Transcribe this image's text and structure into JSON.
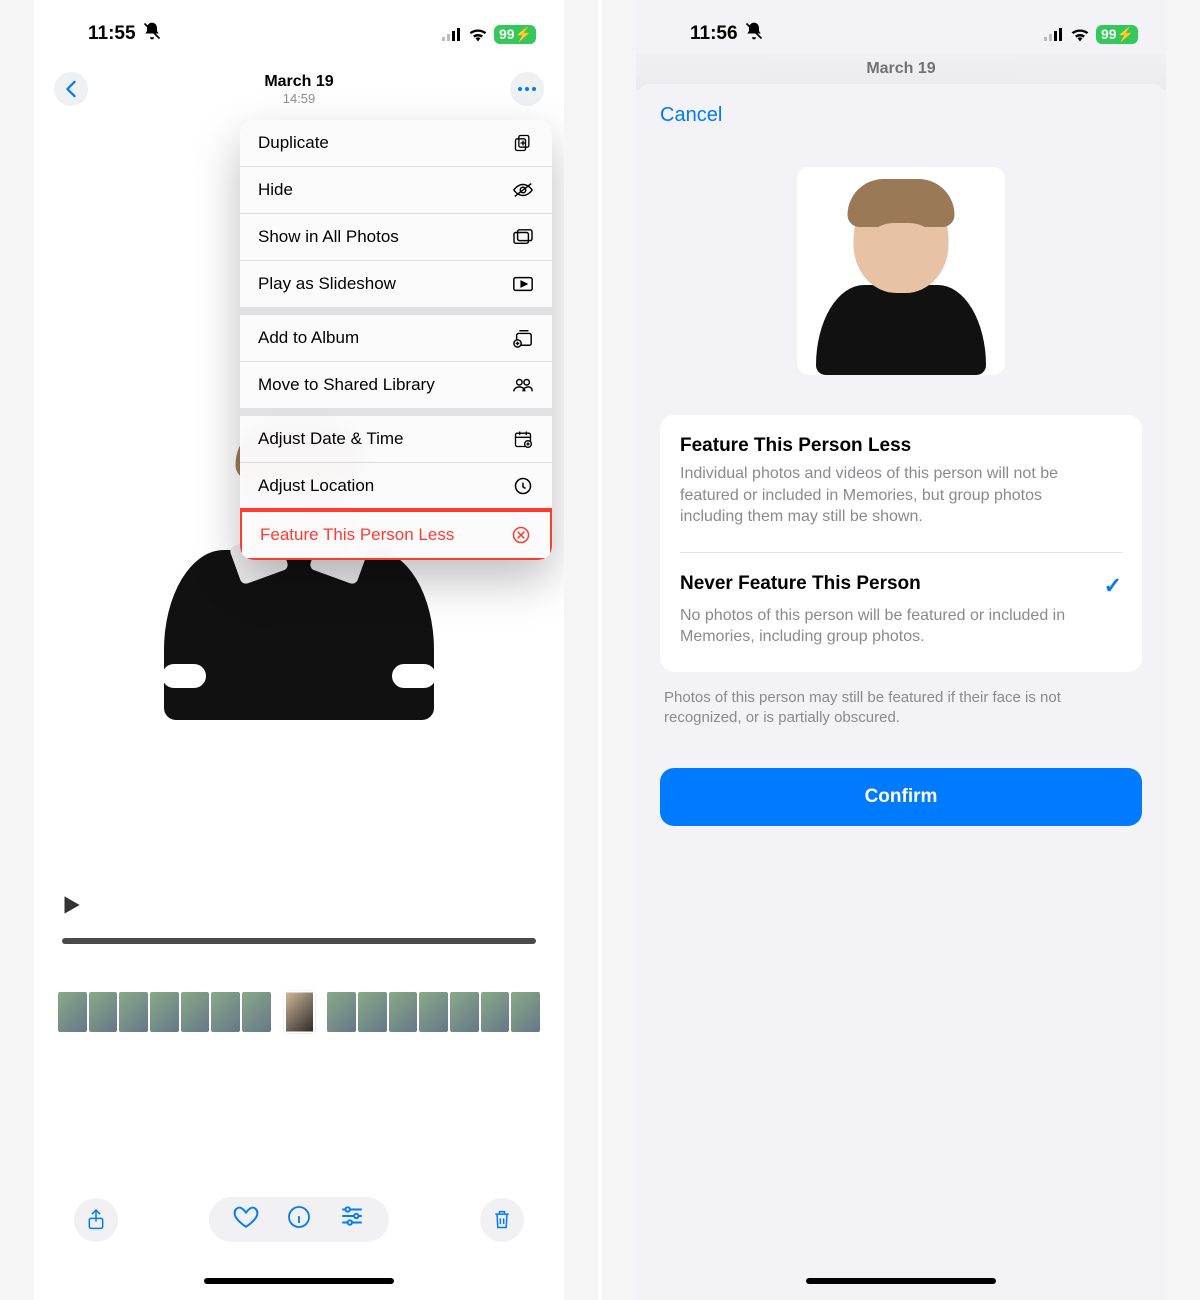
{
  "left": {
    "status": {
      "time": "11:55",
      "battery": "99"
    },
    "header": {
      "date": "March 19",
      "time": "14:59"
    },
    "menu": {
      "group1": [
        {
          "label": "Duplicate",
          "icon": "duplicate-icon"
        },
        {
          "label": "Hide",
          "icon": "hide-icon"
        },
        {
          "label": "Show in All Photos",
          "icon": "all-photos-icon"
        },
        {
          "label": "Play as Slideshow",
          "icon": "slideshow-icon"
        }
      ],
      "group2": [
        {
          "label": "Add to Album",
          "icon": "add-album-icon"
        },
        {
          "label": "Move to Shared Library",
          "icon": "shared-library-icon"
        }
      ],
      "group3": [
        {
          "label": "Adjust Date & Time",
          "icon": "calendar-icon"
        },
        {
          "label": "Adjust Location",
          "icon": "location-icon"
        },
        {
          "label": "Feature This Person Less",
          "icon": "circle-x-icon",
          "destructive": true,
          "highlighted": true
        }
      ]
    }
  },
  "right": {
    "status": {
      "time": "11:56",
      "battery": "99"
    },
    "header_behind": "March 19",
    "cancel": "Cancel",
    "options": [
      {
        "title": "Feature This Person Less",
        "desc": "Individual photos and videos of this person will not be featured or included in Memories, but group photos including them may still be shown.",
        "selected": false
      },
      {
        "title": "Never Feature This Person",
        "desc": "No photos of this person will be featured or included in Memories, including group photos.",
        "selected": true
      }
    ],
    "footnote": "Photos of this person may still be featured if their face is not recognized, or is partially obscured.",
    "confirm": "Confirm"
  }
}
